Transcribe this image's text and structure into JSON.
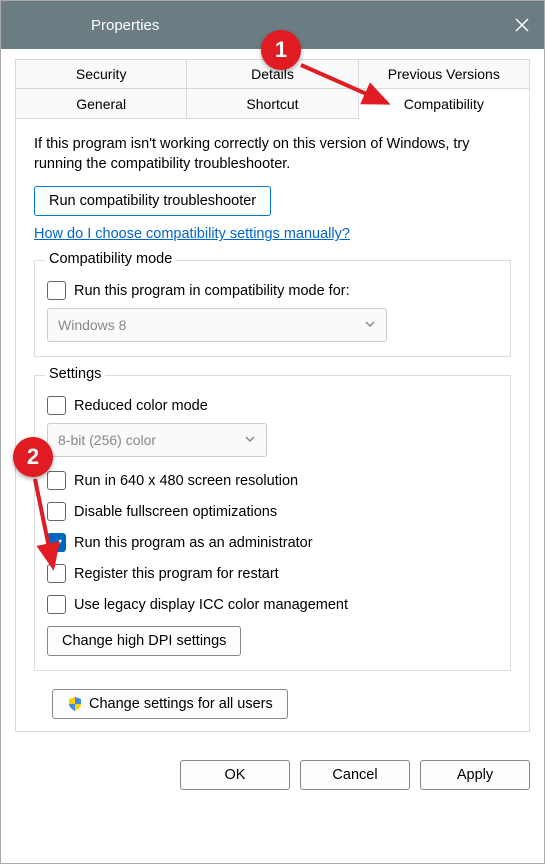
{
  "title": "Properties",
  "tabs_row1": [
    "Security",
    "Details",
    "Previous Versions"
  ],
  "tabs_row2": [
    "General",
    "Shortcut",
    "Compatibility"
  ],
  "intro": "If this program isn't working correctly on this version of Windows, try running the compatibility troubleshooter.",
  "troubleshoot_btn": "Run compatibility troubleshooter",
  "manual_link": "How do I choose compatibility settings manually?",
  "compat_group": "Compatibility mode",
  "compat_check": "Run this program in compatibility mode for:",
  "compat_select": "Windows 8",
  "settings_group": "Settings",
  "reduced_color": "Reduced color mode",
  "color_select": "8-bit (256) color",
  "run640": "Run in 640 x 480 screen resolution",
  "disable_fs": "Disable fullscreen optimizations",
  "run_admin": "Run this program as an administrator",
  "register_restart": "Register this program for restart",
  "legacy_icc": "Use legacy display ICC color management",
  "dpi_btn": "Change high DPI settings",
  "all_users_btn": "Change settings for all users",
  "footer": {
    "ok": "OK",
    "cancel": "Cancel",
    "apply": "Apply"
  },
  "annotations": {
    "step1": "1",
    "step2": "2"
  }
}
